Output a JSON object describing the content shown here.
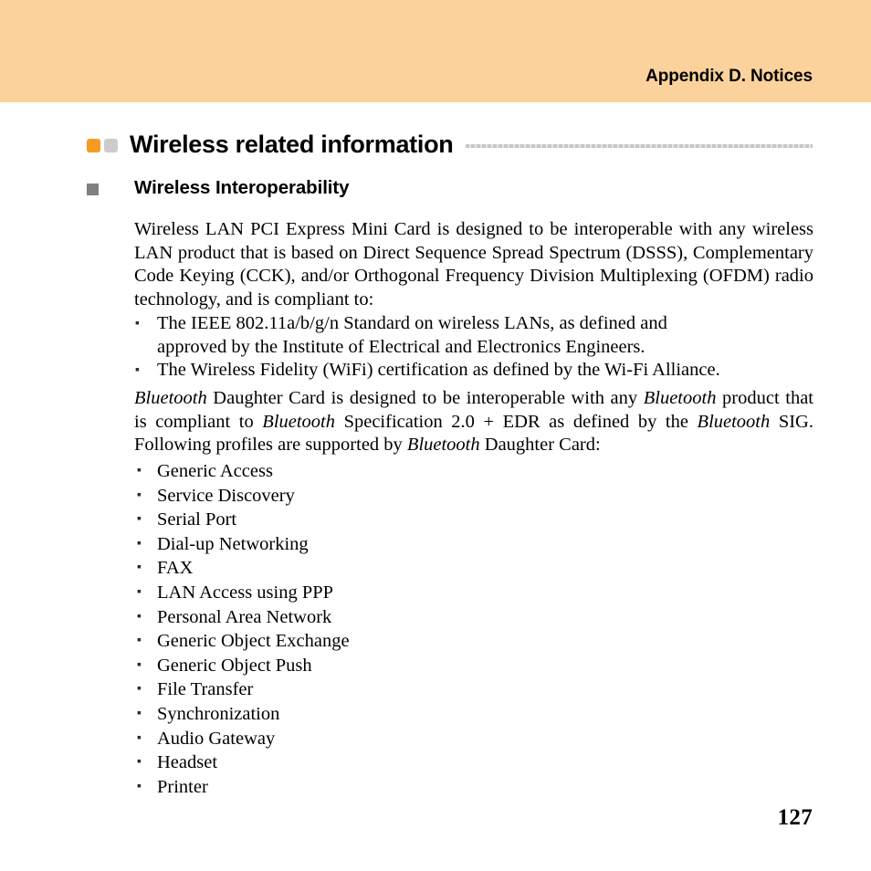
{
  "header": {
    "title": "Appendix D. Notices",
    "band_color": "#fbd29b"
  },
  "heading1": {
    "text": "Wireless related information",
    "square_orange_color": "#f59b23",
    "square_gray_color": "#cccccc",
    "rule_color": "#c6c6c6"
  },
  "heading2": {
    "text": "Wireless Interoperability",
    "bullet_color": "#808080"
  },
  "paragraph1": "Wireless LAN PCI Express Mini Card is designed to be interoperable with any wireless LAN product that is based on Direct Sequence Spread Spectrum (DSSS), Complementary Code Keying (CCK), and/or Orthogonal Frequency Division Multiplexing (OFDM) radio technology, and is compliant to:",
  "standards_bullets": [
    {
      "line1": "The IEEE 802.11a/b/g/n Standard on wireless LANs, as defined and",
      "line2": "approved by the Institute of Electrical and Electronics Engineers."
    },
    {
      "line1": "The Wireless Fidelity (WiFi) certification as defined by the Wi-Fi Alliance.",
      "line2": ""
    }
  ],
  "paragraph2": {
    "seg1": "Bluetooth",
    "seg2": " Daughter Card is designed to be interoperable with any ",
    "seg3": "Bluetooth",
    "seg4": " product that is compliant to ",
    "seg5": "Bluetooth",
    "seg6": " Specification 2.0 + EDR as defined by the ",
    "seg7": "Bluetooth",
    "seg8": " SIG. Following profiles are supported by ",
    "seg9": "Bluetooth",
    "seg10": " Daughter Card:"
  },
  "bullet_glyph": "▪",
  "profiles": [
    "Generic Access",
    "Service Discovery",
    "Serial Port",
    "Dial-up Networking",
    "FAX",
    "LAN Access using PPP",
    "Personal Area Network",
    "Generic Object Exchange",
    "Generic Object Push",
    "File Transfer",
    "Synchronization",
    "Audio Gateway",
    "Headset",
    "Printer"
  ],
  "page_number": "127"
}
